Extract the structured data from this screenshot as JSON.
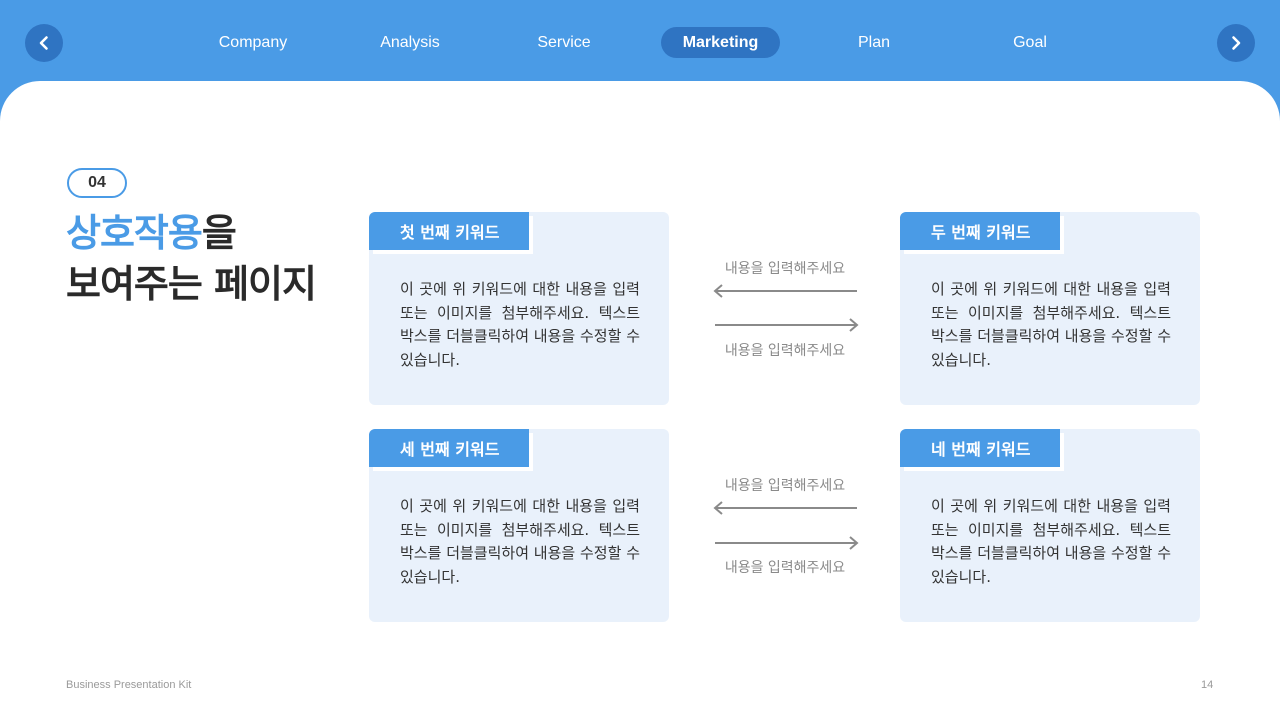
{
  "nav": {
    "prev_icon": "chevron-left-icon",
    "next_icon": "chevron-right-icon",
    "tabs": [
      {
        "label": "Company"
      },
      {
        "label": "Analysis"
      },
      {
        "label": "Service"
      },
      {
        "label": "Marketing"
      },
      {
        "label": "Plan"
      },
      {
        "label": "Goal"
      }
    ],
    "active_tab": "Marketing"
  },
  "slide": {
    "number_badge": "04",
    "title_highlight": "상호작용",
    "title_rest_line1": "을",
    "title_line2": "보여주는 페이지"
  },
  "cards": [
    {
      "label": "첫 번째 키워드",
      "text": "이 곳에 위 키워드에 대한 내용을 입력 또는 이미지를 첨부해주세요. 텍스트 박스를 더블클릭하여 내용을 수정할 수 있습니다."
    },
    {
      "label": "두 번째 키워드",
      "text": "이 곳에 위 키워드에 대한 내용을 입력 또는 이미지를 첨부해주세요. 텍스트 박스를 더블클릭하여 내용을 수정할 수 있습니다."
    },
    {
      "label": "세 번째 키워드",
      "text": "이 곳에 위 키워드에 대한 내용을 입력 또는 이미지를 첨부해주세요. 텍스트 박스를 더블클릭하여 내용을 수정할 수 있습니다."
    },
    {
      "label": "네 번째 키워드",
      "text": "이 곳에 위 키워드에 대한 내용을 입력 또는 이미지를 첨부해주세요. 텍스트 박스를 더블클릭하여 내용을 수정할 수 있습니다."
    }
  ],
  "arrows": [
    {
      "top_label": "내용을 입력해주세요",
      "bottom_label": "내용을 입력해주세요"
    },
    {
      "top_label": "내용을 입력해주세요",
      "bottom_label": "내용을 입력해주세요"
    }
  ],
  "footer": {
    "brand": "Business Presentation Kit",
    "page_number": "14"
  },
  "colors": {
    "accent": "#4a9be6",
    "accent_dark": "#2f74c2",
    "card_bg": "#e9f1fb",
    "arrow": "#8a8a8a"
  }
}
